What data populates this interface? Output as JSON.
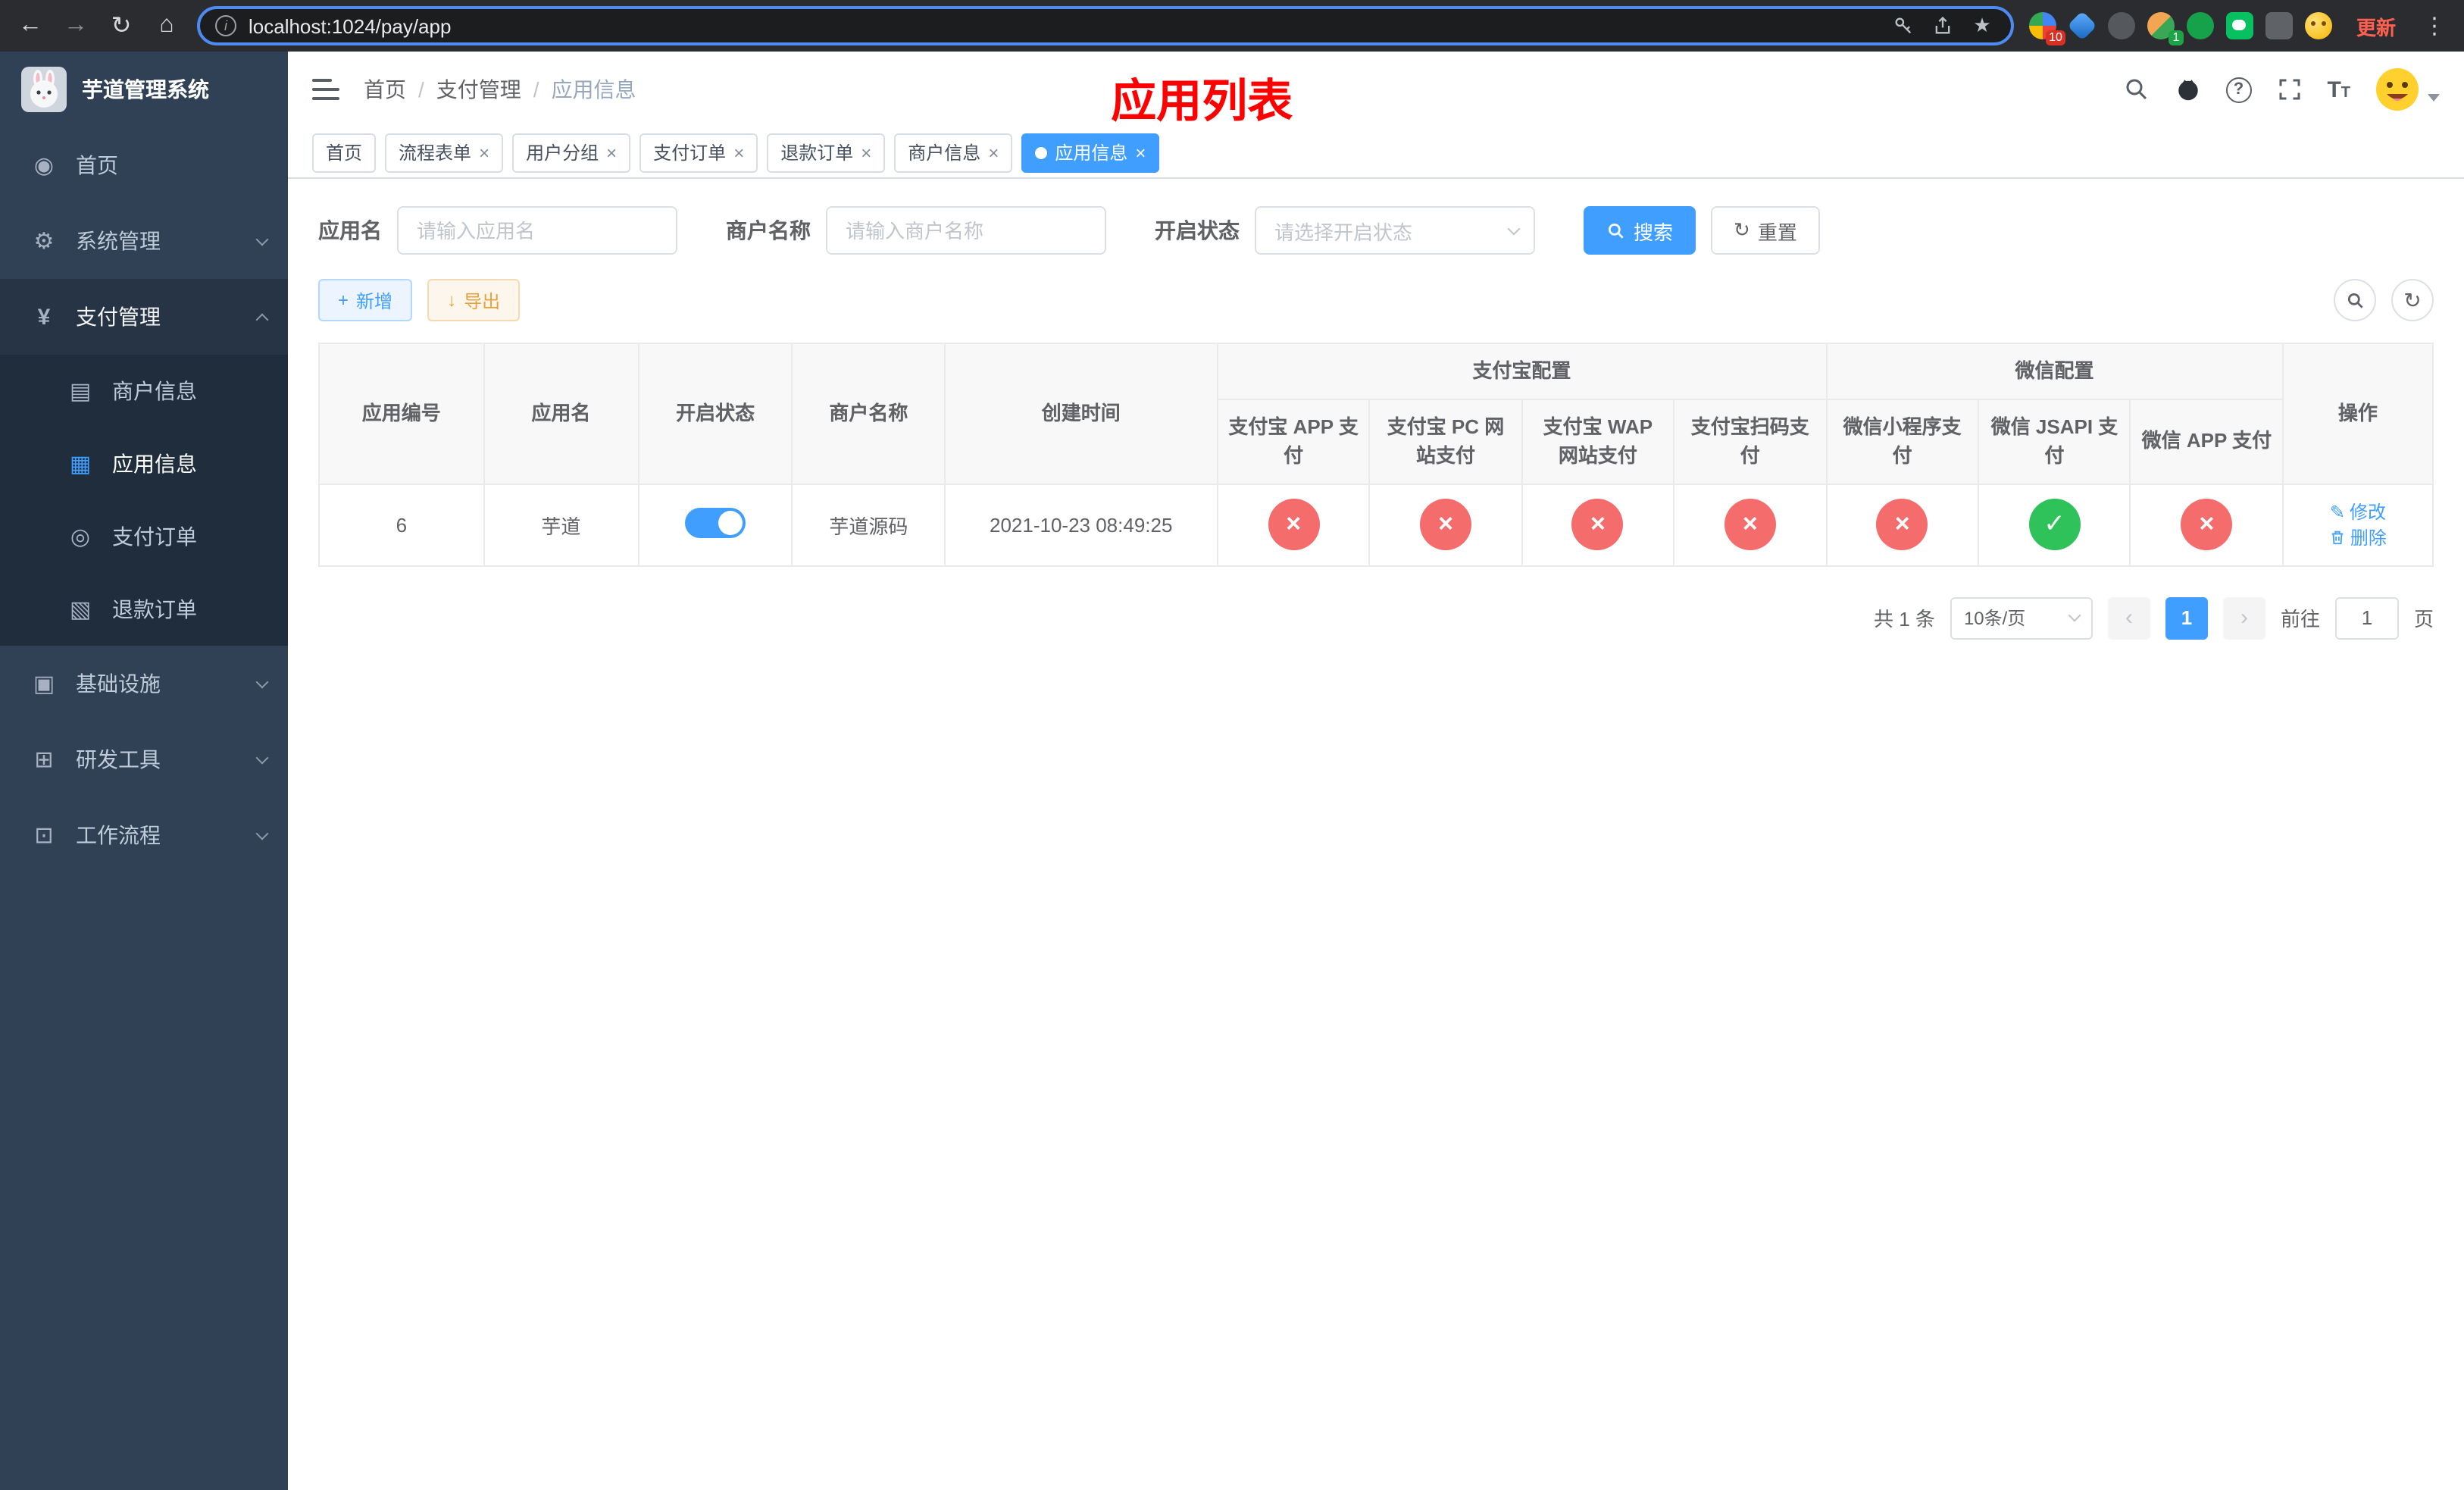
{
  "colors": {
    "accent": "#409eff",
    "success_green": "#2fc25b",
    "error_red": "#f56c6c",
    "title_red": "#ff0000",
    "warning": "#e6a23c",
    "sidebar_bg": "#304156",
    "submenu_bg": "#1f2d3d"
  },
  "icons": {
    "back": "←",
    "forward": "→",
    "reload": "↻",
    "home": "⌂",
    "info": "i",
    "star": "★",
    "kebab": "⋮",
    "dashboard": "◉",
    "gear": "⚙",
    "yen": "¥",
    "card": "▤",
    "grid": "▦",
    "order": "◎",
    "doc": "▧",
    "infra": "▣",
    "tools": "⊞",
    "flow": "⊡",
    "plus": "+",
    "download": "↓",
    "reset": "↻",
    "edit": "✎",
    "prev": "‹",
    "next": "›",
    "close": "×",
    "font_big": "T",
    "font_small": "T",
    "question": "?"
  },
  "browser": {
    "url": "localhost:1024/pay/app",
    "update_label": "更新",
    "extension_badge": "10",
    "avatar_badge": "1"
  },
  "sidebar": {
    "logo_title": "芋道管理系统",
    "menu": [
      {
        "label": "首页"
      },
      {
        "label": "系统管理"
      },
      {
        "label": "支付管理"
      },
      {
        "label": "基础设施"
      },
      {
        "label": "研发工具"
      },
      {
        "label": "工作流程"
      }
    ],
    "submenu_pay": [
      {
        "label": "商户信息"
      },
      {
        "label": "应用信息"
      },
      {
        "label": "支付订单"
      },
      {
        "label": "退款订单"
      }
    ]
  },
  "navbar": {
    "breadcrumb": [
      "首页",
      "支付管理",
      "应用信息"
    ],
    "page_title": "应用列表"
  },
  "tags": [
    {
      "label": "首页"
    },
    {
      "label": "流程表单"
    },
    {
      "label": "用户分组"
    },
    {
      "label": "支付订单"
    },
    {
      "label": "退款订单"
    },
    {
      "label": "商户信息"
    },
    {
      "label": "应用信息"
    }
  ],
  "filters": {
    "app_name_label": "应用名",
    "app_name_placeholder": "请输入应用名",
    "merchant_label": "商户名称",
    "merchant_placeholder": "请输入商户名称",
    "status_label": "开启状态",
    "status_placeholder": "请选择开启状态",
    "search_label": "搜索",
    "reset_label": "重置"
  },
  "toolbar": {
    "add_label": "新增",
    "export_label": "导出"
  },
  "table": {
    "headers": {
      "app_id": "应用编号",
      "app_name": "应用名",
      "status": "开启状态",
      "merchant": "商户名称",
      "created": "创建时间",
      "alipay_group": "支付宝配置",
      "wechat_group": "微信配置",
      "actions": "操作",
      "configs": [
        "支付宝 APP 支付",
        "支付宝 PC 网站支付",
        "支付宝 WAP 网站支付",
        "支付宝扫码支付",
        "微信小程序支付",
        "微信 JSAPI 支付",
        "微信 APP 支付"
      ]
    },
    "rows": [
      {
        "app_id": "6",
        "app_name": "芋道",
        "status": "on",
        "merchant": "芋道源码",
        "created": "2021-10-23 08:49:25",
        "configs": [
          "disabled",
          "disabled",
          "disabled",
          "disabled",
          "disabled",
          "enabled",
          "disabled"
        ],
        "edit_label": "修改",
        "delete_label": "删除"
      }
    ]
  },
  "pagination": {
    "total_text": "共 1 条",
    "page_size": "10条/页",
    "current_page": "1",
    "goto_label": "前往",
    "goto_value": "1",
    "page_unit": "页"
  }
}
